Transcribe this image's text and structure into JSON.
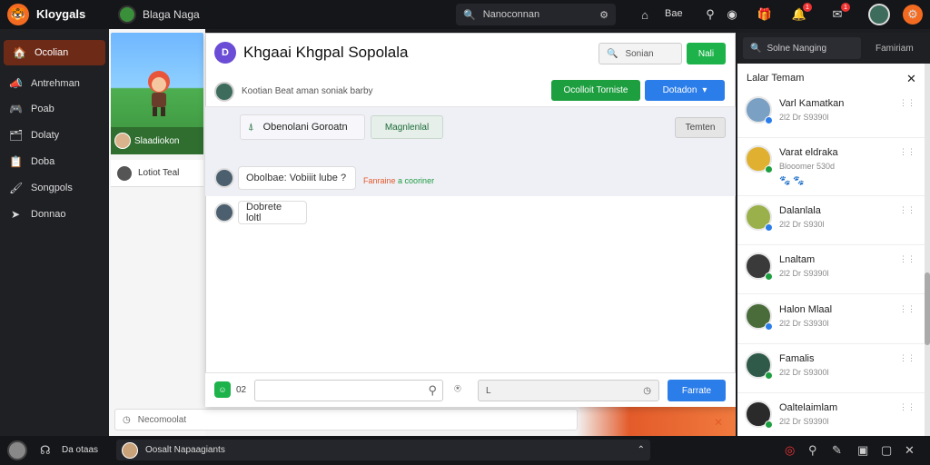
{
  "topbar": {
    "brand_name": "Kloygals",
    "group_name": "Blaga Naga",
    "search_text": "Nanoconnan",
    "home_label": "Bae",
    "badges": [
      "1",
      "1"
    ]
  },
  "sidebar": {
    "items": [
      {
        "label": "Ocolian",
        "icon": "🏠"
      },
      {
        "label": "Antrehman",
        "icon": "📣"
      },
      {
        "label": "Poab",
        "icon": "🎮"
      },
      {
        "label": "Dolaty",
        "icon": "🗂"
      },
      {
        "label": "Doba",
        "icon": "📋"
      },
      {
        "label": "Songpols",
        "icon": "🖌"
      },
      {
        "label": "Donnao",
        "icon": "➤"
      }
    ]
  },
  "midcol": {
    "thumb_caption": "Slaadiokon",
    "card_label": "Lotiot Teal"
  },
  "dialog": {
    "icon_letter": "D",
    "title": "Khgaai Khgpal Sopolala",
    "search_label": "Sonian",
    "go_label": "Nali",
    "sub_text": "Kootian  Beat aman soniak barby",
    "btn_green": "Ocolloit Torniste",
    "btn_blue": "Dotadon",
    "pinned_text": "Obenolani Goroatn",
    "pinned_tag": "Magnlenlal",
    "pinned_right": "Temten",
    "messages": [
      {
        "text": "Obolbae:  Vobiiit lube ?"
      },
      {
        "text": "Dobrete loltl"
      }
    ],
    "msg_meta_red": "Fanraine",
    "msg_meta_green": "a cooriner",
    "compose_count": "02",
    "compose_value": "L",
    "send_label": "Farrate"
  },
  "bottom_note": "Necomoolat",
  "rightpanel": {
    "search_text": "Solne Nanging",
    "tab_label": "Famiriam",
    "header": "Lalar Temam",
    "contacts": [
      {
        "name": "Varl Kamatkan",
        "sub": "2l2 Dr S9390l"
      },
      {
        "name": "Varat eldraka",
        "sub": "Blooomer 530d",
        "extra": "🐾 🐾"
      },
      {
        "name": "Dalanlala",
        "sub": "2l2 Dr S930l"
      },
      {
        "name": "Lnaltam",
        "sub": "2l2 Dr S9390l"
      },
      {
        "name": "Halon Mlaal",
        "sub": "2l2 Dr S3930l"
      },
      {
        "name": "Famalis",
        "sub": "2l2 Dr S9300l"
      },
      {
        "name": "Oaltelaimlam",
        "sub": "2l2 Dr S9390l"
      }
    ]
  },
  "bottombar": {
    "label": "Da otaas",
    "input_text": "Oosalt Napaagiants"
  },
  "colors": {
    "accent_orange": "#f36b21",
    "green": "#1d9e3f",
    "blue": "#2b7de9"
  }
}
